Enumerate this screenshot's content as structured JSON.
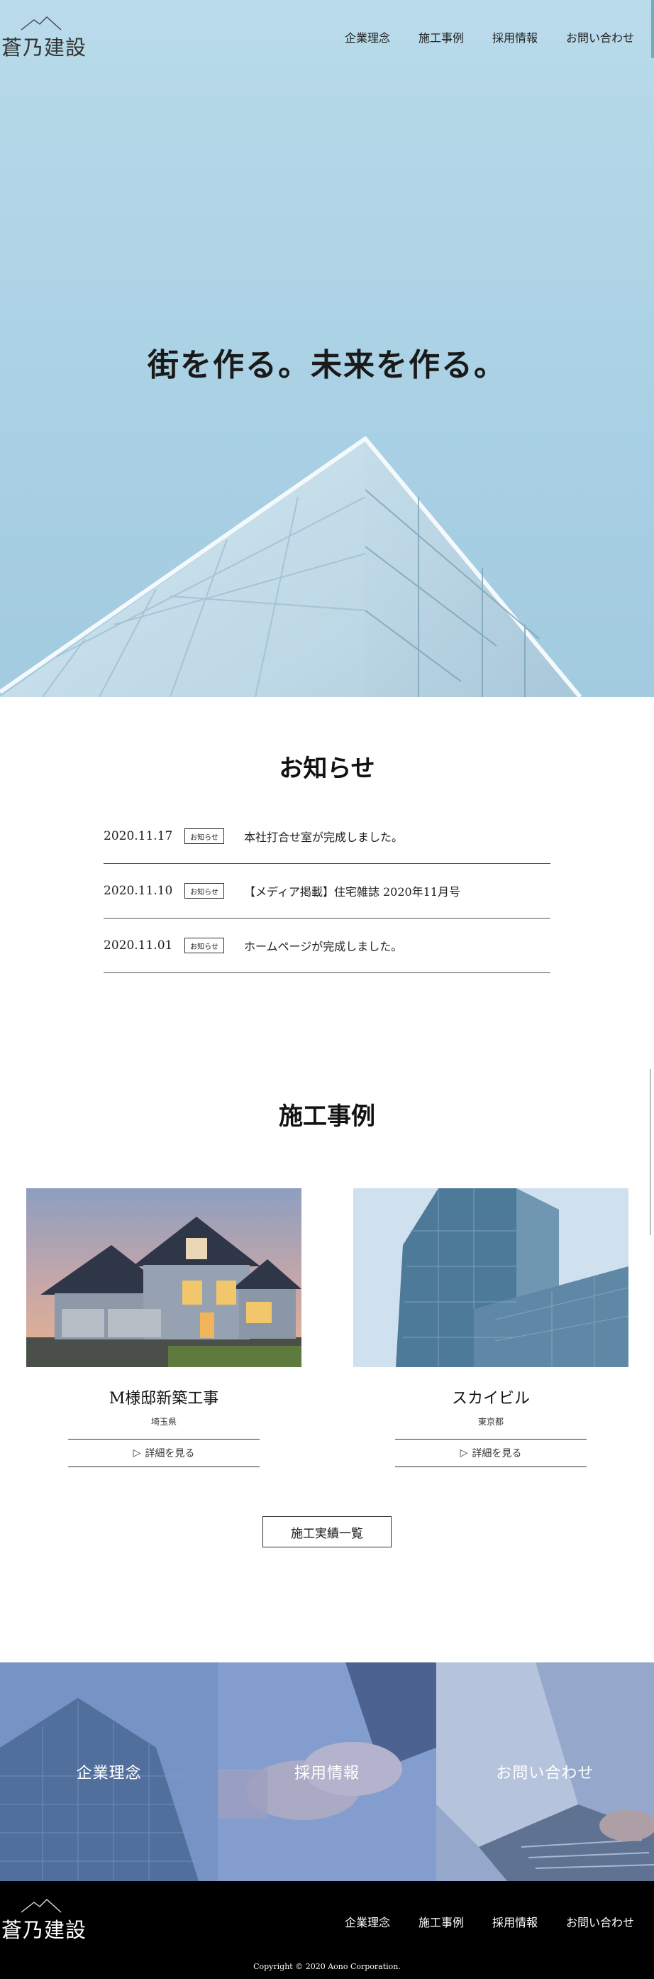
{
  "brand": {
    "name": "蒼乃建設",
    "logo_icon": "mountain-icon"
  },
  "nav": {
    "items": [
      "企業理念",
      "施工事例",
      "採用情報",
      "お問い合わせ"
    ]
  },
  "hero": {
    "title": "街を作る。未来を作る。"
  },
  "news": {
    "title": "お知らせ",
    "items": [
      {
        "date": "2020.11.17",
        "badge": "お知らせ",
        "text": "本社打合せ室が完成しました。"
      },
      {
        "date": "2020.11.10",
        "badge": "お知らせ",
        "text": "【メディア掲載】住宅雑誌 2020年11月号"
      },
      {
        "date": "2020.11.01",
        "badge": "お知らせ",
        "text": "ホームページが完成しました。"
      }
    ]
  },
  "works": {
    "title": "施工事例",
    "items": [
      {
        "name": "M様邸新築工事",
        "location": "埼玉県",
        "detail_label": "詳細を見る"
      },
      {
        "name": "スカイビル",
        "location": "東京都",
        "detail_label": "詳細を見る"
      }
    ],
    "more_label": "施工実績一覧"
  },
  "banners": [
    "企業理念",
    "採用情報",
    "お問い合わせ"
  ],
  "footer": {
    "nav": [
      "企業理念",
      "施工事例",
      "採用情報",
      "お問い合わせ"
    ],
    "copyright": "Copyright © 2020 Aono Corporation."
  },
  "colors": {
    "hero_sky": "#b9dbea",
    "footer_bg": "#000000",
    "banner_tint": "#6f8fc8"
  }
}
